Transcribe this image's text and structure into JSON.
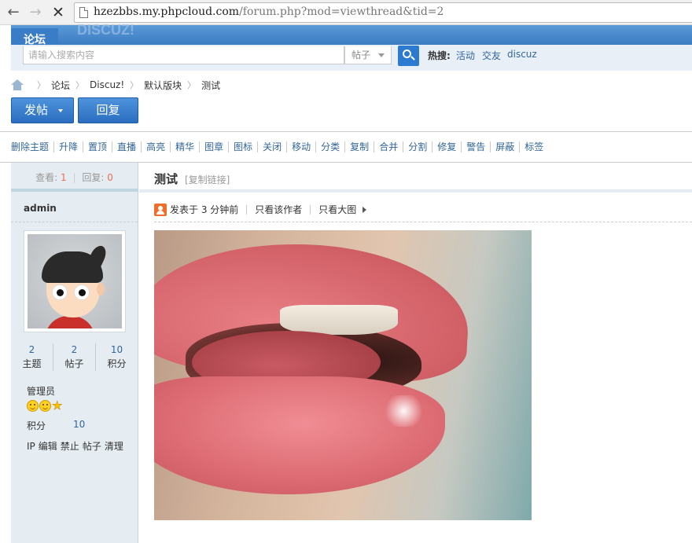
{
  "browser": {
    "url_host": "hzezbbs.my.phpcloud.com",
    "url_rest": "/forum.php?mod=viewthread&tid=2"
  },
  "header": {
    "logo_text": "DISCUZ!",
    "forum_tab": "论坛"
  },
  "search": {
    "placeholder": "请输入搜索内容",
    "type_label": "帖子",
    "hot_label": "热搜:",
    "hot_links": [
      "活动",
      "交友",
      "discuz"
    ]
  },
  "breadcrumb": [
    "论坛",
    "Discuz!",
    "默认版块",
    "测试"
  ],
  "actions": {
    "post_label": "发帖",
    "reply_label": "回复"
  },
  "moderation": [
    "删除主题",
    "升降",
    "置顶",
    "直播",
    "高亮",
    "精华",
    "图章",
    "图标",
    "关闭",
    "移动",
    "分类",
    "复制",
    "合并",
    "分割",
    "修复",
    "警告",
    "屏蔽",
    "标签"
  ],
  "thread_stats": {
    "views_label": "查看:",
    "views": "1",
    "replies_label": "回复:",
    "replies": "0"
  },
  "author": {
    "username": "admin",
    "counts": [
      {
        "value": "2",
        "label": "主题"
      },
      {
        "value": "2",
        "label": "帖子"
      },
      {
        "value": "10",
        "label": "积分"
      }
    ],
    "group": "管理员",
    "credit_label": "积分",
    "credit_value": "10",
    "admin_links": [
      "IP",
      "编辑",
      "禁止",
      "帖子",
      "清理"
    ]
  },
  "post": {
    "title": "测试",
    "copy_link": "[复制链接]",
    "posted": "发表于 3 分钟前",
    "author_only": "只看该作者",
    "big_image": "只看大图"
  },
  "colors": {
    "accent_blue": "#2f6fb8",
    "link": "#336699",
    "stat_red": "#f26c4f"
  }
}
